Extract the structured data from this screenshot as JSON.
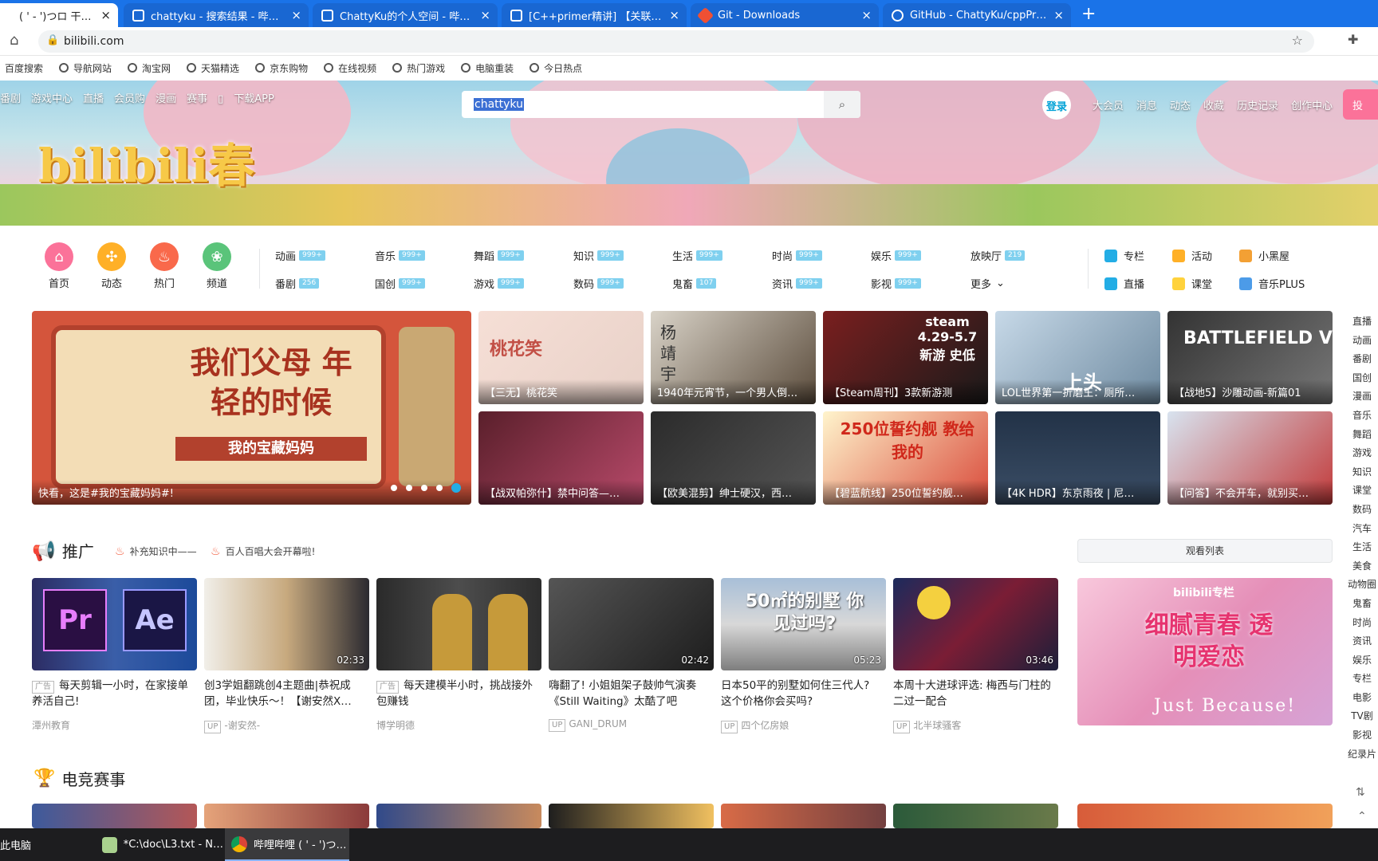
{
  "browser": {
    "tabs": [
      {
        "label": "( ' - ')つロ 干杯~-bili",
        "active": true
      },
      {
        "label": "chattyku - 搜索结果 - 哔哩哔哩",
        "active": false
      },
      {
        "label": "ChattyKu的个人空间 - 哔哩哔哩",
        "active": false
      },
      {
        "label": "[C++primer精讲] 【关联容器",
        "active": false
      },
      {
        "label": "Git - Downloads",
        "active": false
      },
      {
        "label": "GitHub - ChattyKu/cppPrimer",
        "active": false
      }
    ],
    "new_tab": "+",
    "url": "bilibili.com",
    "bookmarks": [
      "百度搜索",
      "导航网站",
      "淘宝网",
      "天猫精选",
      "京东购物",
      "在线视频",
      "热门游戏",
      "电脑重装",
      "今日热点"
    ]
  },
  "header": {
    "nav_left": [
      "番剧",
      "游戏中心",
      "直播",
      "会员购",
      "漫画",
      "赛事",
      "下载APP"
    ],
    "search_value": "chattyku",
    "login": "登录",
    "nav_right": [
      "大会员",
      "消息",
      "动态",
      "收藏",
      "历史记录",
      "创作中心"
    ],
    "post_btn": "投",
    "logo": "bilibili春"
  },
  "channels": {
    "primary": [
      "首页",
      "动态",
      "热门",
      "频道"
    ],
    "row1": [
      {
        "label": "动画",
        "badge": "999+"
      },
      {
        "label": "音乐",
        "badge": "999+"
      },
      {
        "label": "舞蹈",
        "badge": "999+"
      },
      {
        "label": "知识",
        "badge": "999+"
      },
      {
        "label": "生活",
        "badge": "999+"
      },
      {
        "label": "时尚",
        "badge": "999+"
      },
      {
        "label": "娱乐",
        "badge": "999+"
      },
      {
        "label": "放映厅",
        "badge": "219"
      }
    ],
    "row2": [
      {
        "label": "番剧",
        "badge": "256"
      },
      {
        "label": "国创",
        "badge": "999+"
      },
      {
        "label": "游戏",
        "badge": "999+"
      },
      {
        "label": "数码",
        "badge": "999+"
      },
      {
        "label": "鬼畜",
        "badge": "107"
      },
      {
        "label": "资讯",
        "badge": "999+"
      },
      {
        "label": "影视",
        "badge": "999+"
      },
      {
        "label": "更多",
        "badge": ""
      }
    ],
    "extra": [
      "专栏",
      "活动",
      "小黑屋",
      "直播",
      "课堂",
      "音乐PLUS"
    ]
  },
  "carousel": {
    "big_title": "我们父母 年轻的时候",
    "big_sub": "我的宝藏妈妈",
    "caption": "快看，这是#我的宝藏妈妈#!",
    "items": [
      "【三无】桃花笑",
      "1940年元宵节，一个男人倒…",
      "【Steam周刊】3款新游测",
      "LOL世界第一折磨王：厕所…",
      "【战地5】沙雕动画-新篇01",
      "【战双帕弥什】禁中问答—…",
      "【欧美混剪】绅士硬汉，西…",
      "【碧蓝航线】250位誓约舰…",
      "【4K HDR】东京雨夜 | 尼…",
      "【问答】不会开车，就别买…"
    ],
    "thumb_text": [
      "桃花笑",
      "杨靖宇",
      "steam 4.29-5.7 新游 史低",
      "上头",
      "BATTLEFIELD V",
      "",
      "",
      "250位誓约舰 教给我的",
      "",
      ""
    ]
  },
  "promo": {
    "section": "推广",
    "hot": [
      "补充知识中——",
      "百人百唱大会开幕啦!"
    ],
    "watch_list": "观看列表",
    "videos": [
      {
        "title": "每天剪辑一小时，在家接单养活自己!",
        "up": "潭州教育",
        "duration": "",
        "ad": "广告",
        "thumb": "Pr  Ae"
      },
      {
        "title": "创3学姐翻跳创4主题曲|恭祝成团，毕业快乐～！【谢安然X…",
        "up": "-谢安然-",
        "duration": "02:33",
        "ad": "",
        "thumb": ""
      },
      {
        "title": "每天建模半小时，挑战接外包赚钱",
        "up": "博学明德",
        "duration": "",
        "ad": "广告",
        "thumb": ""
      },
      {
        "title": "嗨翻了! 小姐姐架子鼓帅气演奏《Still Waiting》太酷了吧",
        "up": "GANI_DRUM",
        "duration": "02:42",
        "ad": "",
        "thumb": ""
      },
      {
        "title": "日本50平的别墅如何住三代人? 这个价格你会买吗?",
        "up": "四个亿房娘",
        "duration": "05:23",
        "ad": "",
        "thumb": "50㎡的别墅 你见过吗?"
      },
      {
        "title": "本周十大进球评选: 梅西与门柱的二过一配合",
        "up": "北半球骚客",
        "duration": "03:46",
        "ad": "",
        "thumb": ""
      }
    ],
    "side_banner": {
      "brand": "bilibili专栏",
      "title": "细腻青春 透明爱恋",
      "sub": "Just Because!"
    }
  },
  "esports": {
    "section": "电竞赛事"
  },
  "rail": [
    "直播",
    "动画",
    "番剧",
    "国创",
    "漫画",
    "音乐",
    "舞蹈",
    "游戏",
    "知识",
    "课堂",
    "数码",
    "汽车",
    "生活",
    "美食",
    "动物圈",
    "鬼畜",
    "时尚",
    "资讯",
    "娱乐",
    "专栏",
    "电影",
    "TV剧",
    "影视",
    "纪录片"
  ],
  "taskbar": [
    {
      "label": "此电脑"
    },
    {
      "label": "*C:\\doc\\L3.txt - N…"
    },
    {
      "label": "哔哩哔哩 ( ' - ')つ…"
    }
  ],
  "colors": {
    "brand_pink": "#fb7299",
    "brand_blue": "#00a1d6",
    "chrome_blue": "#1a73e8"
  }
}
